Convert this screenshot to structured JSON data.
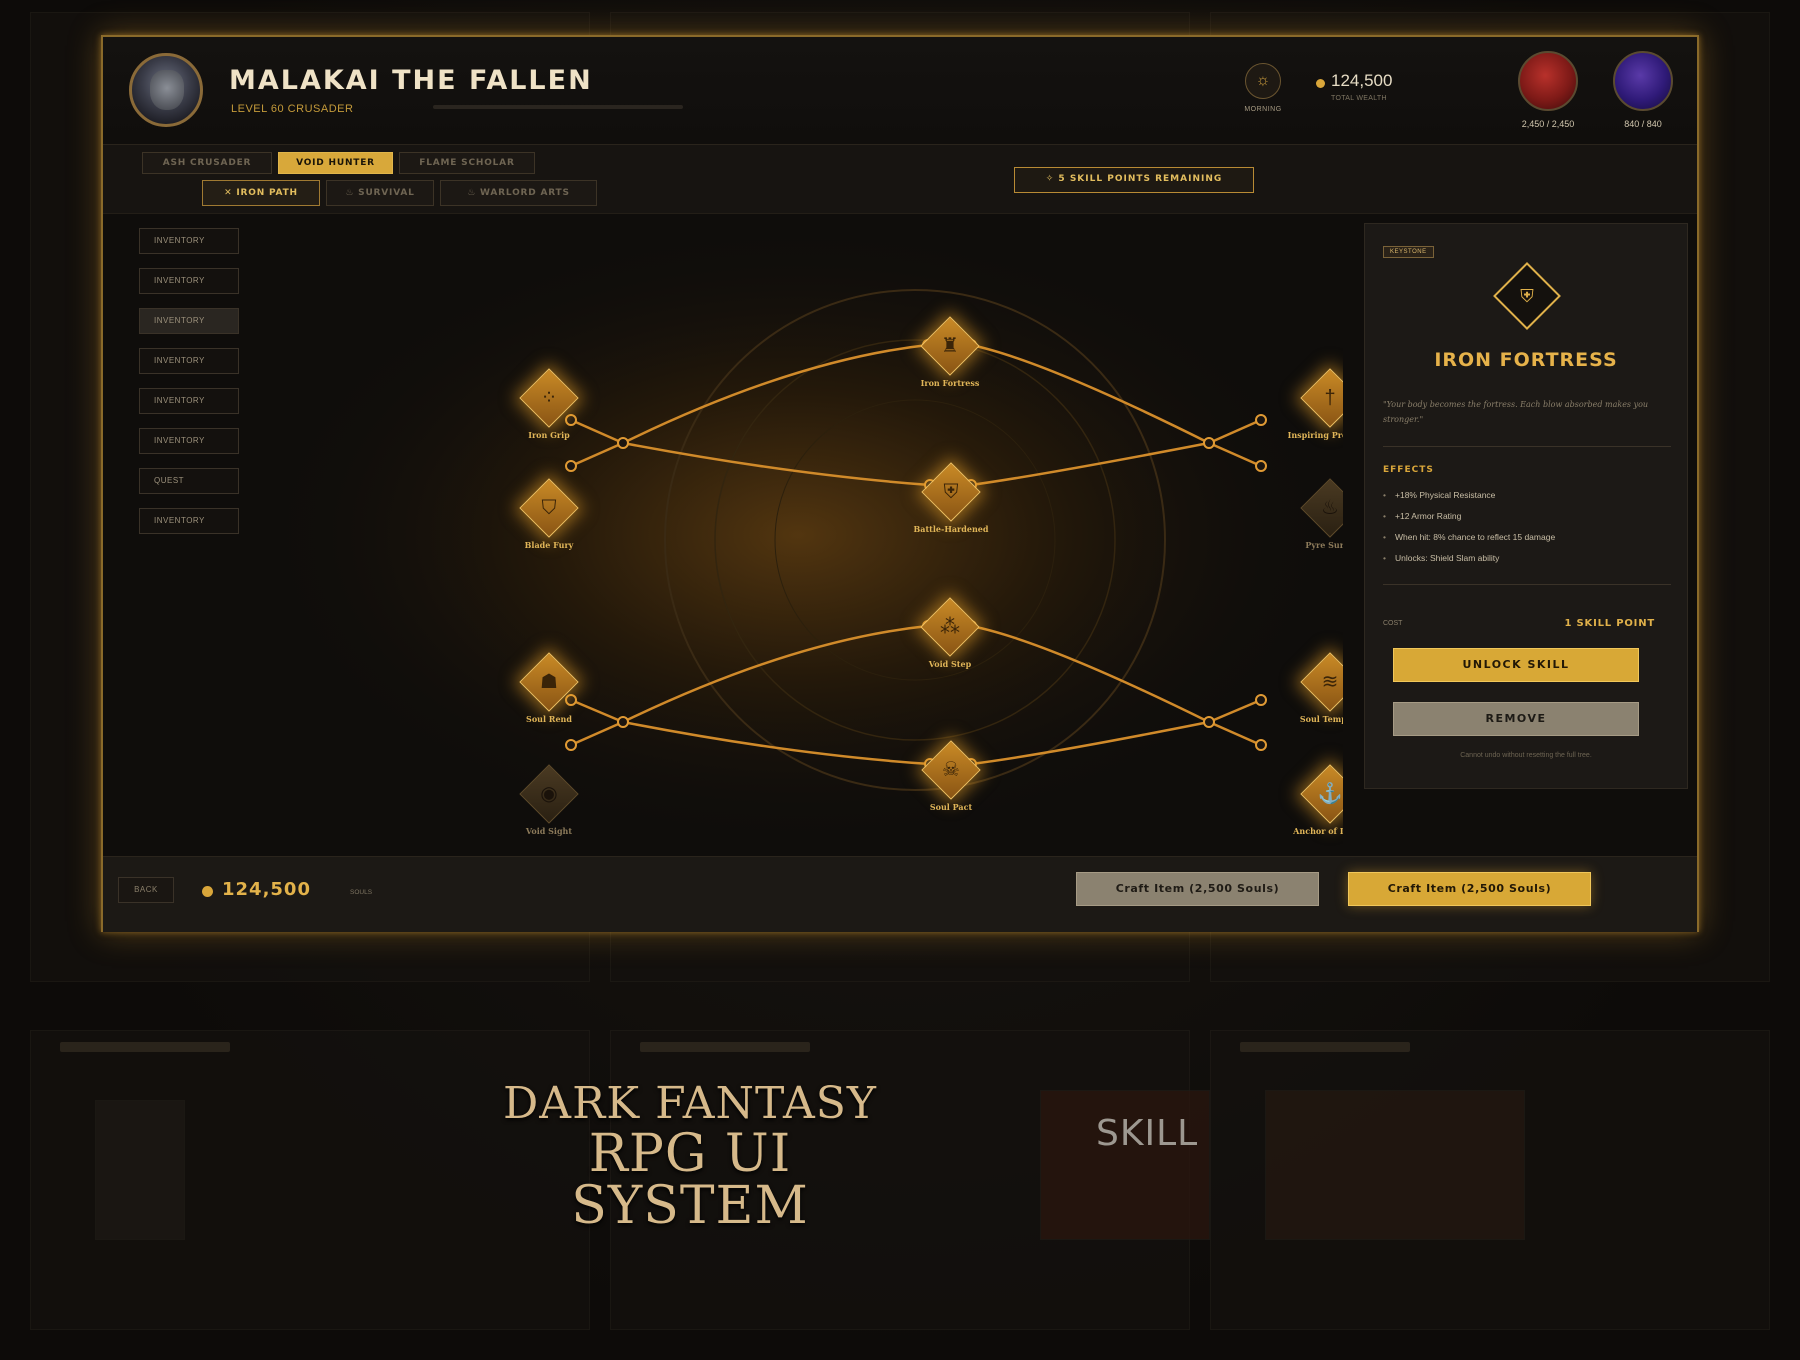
{
  "character": {
    "name": "MALAKAI THE FALLEN",
    "class": "LEVEL 60 CRUSADER",
    "time_of_day": "MORNING",
    "wealth": "124,500",
    "wealth_label": "TOTAL WEALTH",
    "health": "2,450 / 2,450",
    "mana": "840 / 840"
  },
  "classes": [
    "ASH CRUSADER",
    "VOID HUNTER",
    "FLAME SCHOLAR"
  ],
  "active_class_index": 1,
  "trees": [
    {
      "label": "IRON PATH",
      "icon": "crossed-swords-icon"
    },
    {
      "label": "SURVIVAL",
      "icon": "flame-icon"
    },
    {
      "label": "WARLORD ARTS",
      "icon": "flame-icon"
    }
  ],
  "active_tree_index": 0,
  "skill_points": "5 SKILL POINTS REMAINING",
  "sidebar": [
    "INVENTORY",
    "INVENTORY",
    "INVENTORY",
    "INVENTORY",
    "INVENTORY",
    "INVENTORY",
    "QUEST",
    "INVENTORY"
  ],
  "sidebar_active_index": 2,
  "skills": [
    {
      "id": "iron-grip",
      "label": "Iron Grip",
      "icon": "grip-dots-icon",
      "glyph": "⁘",
      "unlocked": true
    },
    {
      "id": "blade-fury",
      "label": "Blade Fury",
      "icon": "shield-sword-icon",
      "glyph": "⛉",
      "unlocked": true
    },
    {
      "id": "iron-fortress",
      "label": "Iron Fortress",
      "icon": "tower-icon",
      "glyph": "♜",
      "unlocked": true
    },
    {
      "id": "battle-hardened",
      "label": "Battle-Hardened",
      "icon": "shield-icon",
      "glyph": "⛨",
      "unlocked": true
    },
    {
      "id": "inspiring-presence",
      "label": "Inspiring Presence",
      "icon": "sword-icon",
      "glyph": "†",
      "unlocked": true
    },
    {
      "id": "pyre-surge",
      "label": "Pyre Surge",
      "icon": "flame-icon",
      "glyph": "♨",
      "unlocked": false
    },
    {
      "id": "soul-rend",
      "label": "Soul Rend",
      "icon": "ghost-icon",
      "glyph": "☗",
      "unlocked": true
    },
    {
      "id": "void-sight",
      "label": "Void Sight",
      "icon": "eye-icon",
      "glyph": "◉",
      "unlocked": false
    },
    {
      "id": "void-step",
      "label": "Void Step",
      "icon": "footsteps-icon",
      "glyph": "⁂",
      "unlocked": true
    },
    {
      "id": "soul-pact",
      "label": "Soul Pact",
      "icon": "skull-icon",
      "glyph": "☠",
      "unlocked": true
    },
    {
      "id": "soul-tempest",
      "label": "Soul Tempest",
      "icon": "wind-icon",
      "glyph": "≋",
      "unlocked": true
    },
    {
      "id": "anchor-of-dread",
      "label": "Anchor of Dread",
      "icon": "anchor-icon",
      "glyph": "⚓",
      "unlocked": true
    }
  ],
  "detail": {
    "tag": "KEYSTONE",
    "icon": "shield-icon",
    "title": "IRON FORTRESS",
    "quote": "\"Your body becomes the fortress. Each blow absorbed makes you stronger.\"",
    "effects_title": "EFFECTS",
    "effects": [
      "+18% Physical Resistance",
      "+12 Armor Rating",
      "When hit: 8% chance to reflect 15 damage",
      "Unlocks: Shield Slam ability"
    ],
    "cost_label": "COST",
    "cost": "1 SKILL POINT",
    "unlock_label": "UNLOCK SKILL",
    "remove_label": "REMOVE",
    "note": "Cannot undo without resetting the full tree."
  },
  "footer": {
    "back_label": "BACK",
    "souls": "124,500",
    "souls_label": "SOULS",
    "craft_secondary": "Craft Item (2,500 Souls)",
    "craft_primary": "Craft Item (2,500 Souls)"
  },
  "promo": {
    "line1": "DARK FANTASY",
    "line2": "RPG UI SYSTEM",
    "section": "SKILL"
  },
  "colors": {
    "accent": "#d8a836",
    "panel": "#1c1916",
    "hp": "#b8312b",
    "mp": "#5a3aa8"
  }
}
